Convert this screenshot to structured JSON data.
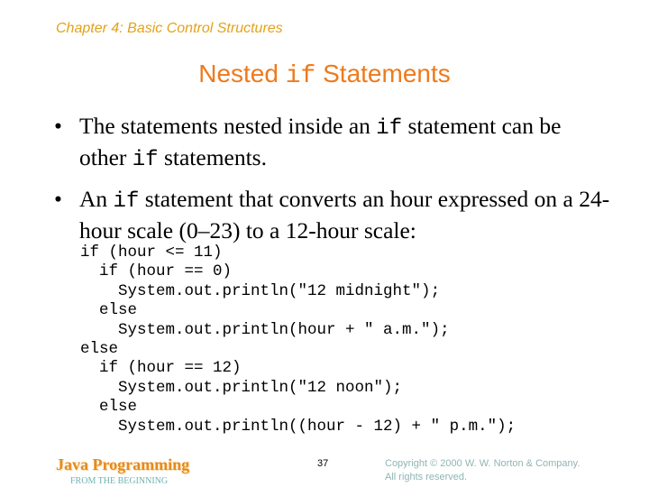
{
  "header": {
    "chapter": "Chapter 4: Basic Control Structures"
  },
  "title": {
    "before": "Nested ",
    "code": "if",
    "after": " Statements"
  },
  "bullets": [
    {
      "marker": "•",
      "segments": [
        {
          "text": "The statements nested inside an ",
          "code": false
        },
        {
          "text": "if",
          "code": true
        },
        {
          "text": " statement can be other ",
          "code": false
        },
        {
          "text": "if",
          "code": true
        },
        {
          "text": " statements.",
          "code": false
        }
      ]
    },
    {
      "marker": "•",
      "segments": [
        {
          "text": "An ",
          "code": false
        },
        {
          "text": "if",
          "code": true
        },
        {
          "text": " statement that converts an hour expressed on a 24-hour scale (0–23) to a 12-hour scale:",
          "code": false
        }
      ]
    }
  ],
  "code_lines": [
    "if (hour <= 11)",
    "  if (hour == 0)",
    "    System.out.println(\"12 midnight\");",
    "  else",
    "    System.out.println(hour + \" a.m.\");",
    "else",
    "  if (hour == 12)",
    "    System.out.println(\"12 noon\");",
    "  else",
    "    System.out.println((hour - 12) + \" p.m.\");"
  ],
  "footer": {
    "brand": "Java Programming",
    "subtitle": "FROM THE BEGINNING",
    "page_number": "37",
    "copyright_line1": "Copyright © 2000 W. W. Norton & Company.",
    "copyright_line2": "All rights reserved."
  },
  "colors": {
    "chapter": "#e3a21a",
    "title": "#ee7a1c",
    "brand": "#e88a1a",
    "subtitle": "#6fb3b0",
    "copyright": "#8fb5b3"
  }
}
